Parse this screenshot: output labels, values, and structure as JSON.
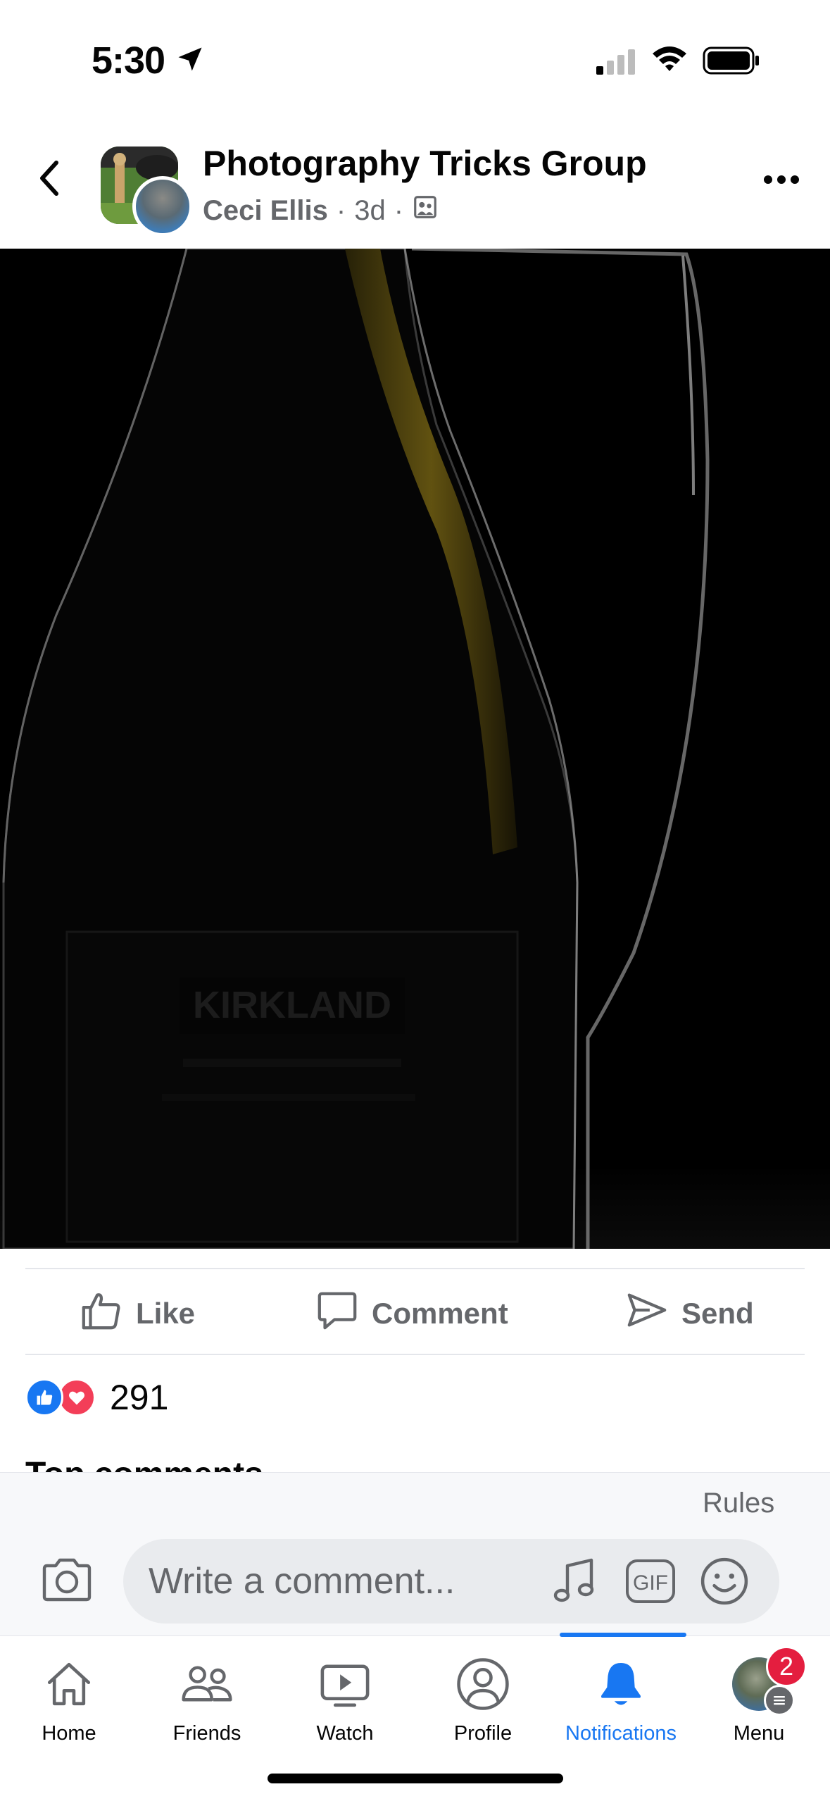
{
  "status_bar": {
    "time": "5:30",
    "location_icon": "location-arrow-icon",
    "signal_icon": "cellular-signal-icon",
    "wifi_icon": "wifi-icon",
    "battery_icon": "battery-icon"
  },
  "header": {
    "back_icon": "chevron-left-icon",
    "group_name": "Photography Tricks Group",
    "author": "Ceci Ellis",
    "time_ago": "3d",
    "separator": "·",
    "audience_icon": "group-members-icon",
    "more_icon": "more-horizontal-icon"
  },
  "photo": {
    "label_text": "KIRKLAND"
  },
  "actions": {
    "like": "Like",
    "comment": "Comment",
    "send": "Send"
  },
  "reactions": {
    "count": "291",
    "types": [
      "like",
      "love"
    ]
  },
  "comments": {
    "section_title": "Top comments"
  },
  "composer": {
    "rules": "Rules",
    "placeholder": "Write a comment...",
    "camera_icon": "camera-icon",
    "music_icon": "music-note-icon",
    "gif_label": "GIF",
    "emoji_icon": "smiley-icon"
  },
  "tabbar": {
    "tabs": [
      {
        "label": "Home",
        "icon": "home-icon"
      },
      {
        "label": "Friends",
        "icon": "friends-icon"
      },
      {
        "label": "Watch",
        "icon": "watch-icon"
      },
      {
        "label": "Profile",
        "icon": "profile-icon"
      },
      {
        "label": "Notifications",
        "icon": "bell-icon",
        "active": true
      },
      {
        "label": "Menu",
        "icon": "avatar-menu-icon"
      }
    ],
    "menu_badge": "2"
  },
  "colors": {
    "accent": "#1877f2",
    "secondary_text": "#65676b",
    "badge": "#e41e3f",
    "love": "#f33e58"
  }
}
